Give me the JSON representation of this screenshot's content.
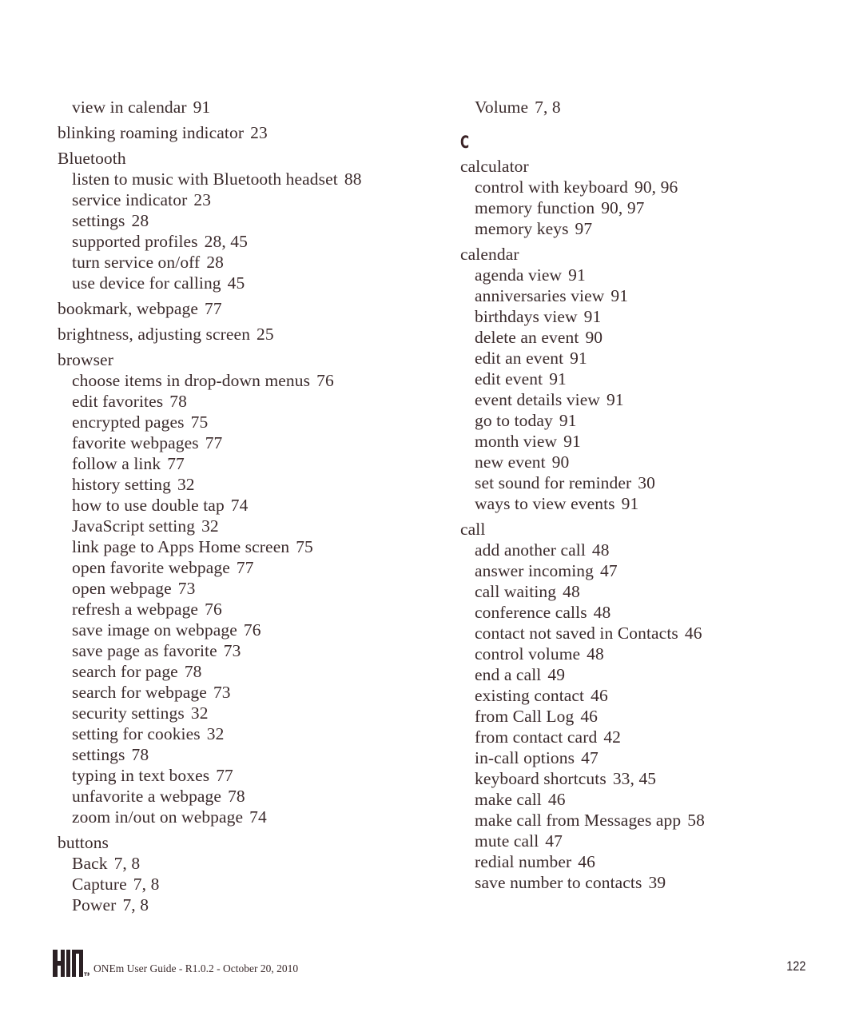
{
  "left_column": [
    {
      "term": "view in calendar",
      "pages": "91",
      "level": 2,
      "gap": false
    },
    {
      "term": "blinking roaming indicator",
      "pages": "23",
      "level": 1,
      "gap": true
    },
    {
      "term": "Bluetooth",
      "pages": "",
      "level": 1,
      "gap": true
    },
    {
      "term": "listen to music with Bluetooth headset",
      "pages": "88",
      "level": 2,
      "gap": false
    },
    {
      "term": "service indicator",
      "pages": "23",
      "level": 2,
      "gap": false
    },
    {
      "term": "settings",
      "pages": "28",
      "level": 2,
      "gap": false
    },
    {
      "term": "supported profiles",
      "pages": "28, 45",
      "level": 2,
      "gap": false
    },
    {
      "term": "turn service on/off",
      "pages": "28",
      "level": 2,
      "gap": false
    },
    {
      "term": "use device for calling",
      "pages": "45",
      "level": 2,
      "gap": false
    },
    {
      "term": "bookmark, webpage",
      "pages": "77",
      "level": 1,
      "gap": true
    },
    {
      "term": "brightness, adjusting screen",
      "pages": "25",
      "level": 1,
      "gap": true
    },
    {
      "term": "browser",
      "pages": "",
      "level": 1,
      "gap": true
    },
    {
      "term": "choose items in drop-down menus",
      "pages": "76",
      "level": 2,
      "gap": false
    },
    {
      "term": "edit favorites",
      "pages": "78",
      "level": 2,
      "gap": false
    },
    {
      "term": "encrypted pages",
      "pages": "75",
      "level": 2,
      "gap": false
    },
    {
      "term": "favorite webpages",
      "pages": "77",
      "level": 2,
      "gap": false
    },
    {
      "term": "follow a link",
      "pages": "77",
      "level": 2,
      "gap": false
    },
    {
      "term": "history setting",
      "pages": "32",
      "level": 2,
      "gap": false
    },
    {
      "term": "how to use double tap",
      "pages": "74",
      "level": 2,
      "gap": false
    },
    {
      "term": "JavaScript setting",
      "pages": "32",
      "level": 2,
      "gap": false
    },
    {
      "term": "link page to Apps Home screen",
      "pages": "75",
      "level": 2,
      "gap": false
    },
    {
      "term": "open favorite webpage",
      "pages": "77",
      "level": 2,
      "gap": false
    },
    {
      "term": "open webpage",
      "pages": "73",
      "level": 2,
      "gap": false
    },
    {
      "term": "refresh a webpage",
      "pages": "76",
      "level": 2,
      "gap": false
    },
    {
      "term": "save image on webpage",
      "pages": "76",
      "level": 2,
      "gap": false
    },
    {
      "term": "save page as favorite",
      "pages": "73",
      "level": 2,
      "gap": false
    },
    {
      "term": "search for page",
      "pages": "78",
      "level": 2,
      "gap": false
    },
    {
      "term": "search for webpage",
      "pages": "73",
      "level": 2,
      "gap": false
    },
    {
      "term": "security settings",
      "pages": "32",
      "level": 2,
      "gap": false
    },
    {
      "term": "setting for cookies",
      "pages": "32",
      "level": 2,
      "gap": false
    },
    {
      "term": "settings",
      "pages": "78",
      "level": 2,
      "gap": false
    },
    {
      "term": "typing in text boxes",
      "pages": "77",
      "level": 2,
      "gap": false
    },
    {
      "term": "unfavorite a webpage",
      "pages": "78",
      "level": 2,
      "gap": false
    },
    {
      "term": "zoom in/out on webpage",
      "pages": "74",
      "level": 2,
      "gap": false
    },
    {
      "term": "buttons",
      "pages": "",
      "level": 1,
      "gap": true
    },
    {
      "term": "Back",
      "pages": "7, 8",
      "level": 2,
      "gap": false
    },
    {
      "term": "Capture",
      "pages": "7, 8",
      "level": 2,
      "gap": false
    },
    {
      "term": "Power",
      "pages": "7, 8",
      "level": 2,
      "gap": false
    }
  ],
  "right_column": [
    {
      "term": "Volume",
      "pages": "7, 8",
      "level": 2,
      "gap": false
    },
    {
      "letter": "C"
    },
    {
      "term": "calculator",
      "pages": "",
      "level": 1,
      "gap": false
    },
    {
      "term": "control with keyboard",
      "pages": "90, 96",
      "level": 2,
      "gap": false
    },
    {
      "term": "memory function",
      "pages": "90, 97",
      "level": 2,
      "gap": false
    },
    {
      "term": "memory keys",
      "pages": "97",
      "level": 2,
      "gap": false
    },
    {
      "term": "calendar",
      "pages": "",
      "level": 1,
      "gap": true
    },
    {
      "term": "agenda view",
      "pages": "91",
      "level": 2,
      "gap": false
    },
    {
      "term": "anniversaries view",
      "pages": "91",
      "level": 2,
      "gap": false
    },
    {
      "term": "birthdays view",
      "pages": "91",
      "level": 2,
      "gap": false
    },
    {
      "term": "delete an event",
      "pages": "90",
      "level": 2,
      "gap": false
    },
    {
      "term": "edit an event",
      "pages": "91",
      "level": 2,
      "gap": false
    },
    {
      "term": "edit event",
      "pages": "91",
      "level": 2,
      "gap": false
    },
    {
      "term": "event details view",
      "pages": "91",
      "level": 2,
      "gap": false
    },
    {
      "term": "go to today",
      "pages": "91",
      "level": 2,
      "gap": false
    },
    {
      "term": "month view",
      "pages": "91",
      "level": 2,
      "gap": false
    },
    {
      "term": "new event",
      "pages": "90",
      "level": 2,
      "gap": false
    },
    {
      "term": "set sound for reminder",
      "pages": "30",
      "level": 2,
      "gap": false
    },
    {
      "term": "ways to view events",
      "pages": "91",
      "level": 2,
      "gap": false
    },
    {
      "term": "call",
      "pages": "",
      "level": 1,
      "gap": true
    },
    {
      "term": "add another call",
      "pages": "48",
      "level": 2,
      "gap": false
    },
    {
      "term": "answer incoming",
      "pages": "47",
      "level": 2,
      "gap": false
    },
    {
      "term": "call waiting",
      "pages": "48",
      "level": 2,
      "gap": false
    },
    {
      "term": "conference calls",
      "pages": "48",
      "level": 2,
      "gap": false
    },
    {
      "term": "contact not saved in Contacts",
      "pages": "46",
      "level": 2,
      "gap": false
    },
    {
      "term": "control volume",
      "pages": "48",
      "level": 2,
      "gap": false
    },
    {
      "term": "end a call",
      "pages": "49",
      "level": 2,
      "gap": false
    },
    {
      "term": "existing contact",
      "pages": "46",
      "level": 2,
      "gap": false
    },
    {
      "term": "from Call Log",
      "pages": "46",
      "level": 2,
      "gap": false
    },
    {
      "term": "from contact card",
      "pages": "42",
      "level": 2,
      "gap": false
    },
    {
      "term": "in-call options",
      "pages": "47",
      "level": 2,
      "gap": false
    },
    {
      "term": "keyboard shortcuts",
      "pages": "33, 45",
      "level": 2,
      "gap": false
    },
    {
      "term": "make call",
      "pages": "46",
      "level": 2,
      "gap": false
    },
    {
      "term": "make call from Messages app",
      "pages": "58",
      "level": 2,
      "gap": false
    },
    {
      "term": "mute call",
      "pages": "47",
      "level": 2,
      "gap": false
    },
    {
      "term": "redial number",
      "pages": "46",
      "level": 2,
      "gap": false
    },
    {
      "term": "save number to contacts",
      "pages": "39",
      "level": 2,
      "gap": false
    }
  ],
  "footer": {
    "logo": "KIN",
    "logo_trademark": "TM",
    "logo_icon": "kin-logo-icon",
    "text": "ONEm User Guide - R1.0.2 - October 20, 2010",
    "page_number": "122"
  },
  "colors": {
    "text": "#3b2b2c",
    "background": "#ffffff"
  }
}
